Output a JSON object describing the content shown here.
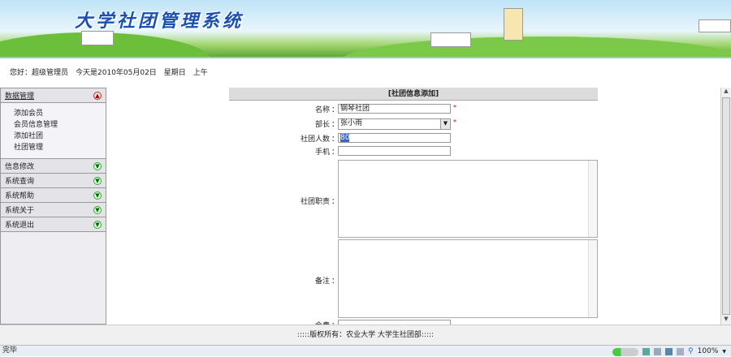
{
  "banner": {
    "title": "大学社团管理系统"
  },
  "greeting": "您好：超级管理员　今天是2010年05月02日　星期日　上午",
  "sidebar": {
    "open_menu": {
      "label": "数据管理",
      "items": [
        "添加会员",
        "会员信息管理",
        "添加社团",
        "社团管理"
      ]
    },
    "menus": [
      "信息修改",
      "系统查询",
      "系统帮助",
      "系统关于",
      "系统退出"
    ]
  },
  "form": {
    "title": "[社团信息添加]",
    "name_label": "名称",
    "name_value": "钢琴社团",
    "leader_label": "部长",
    "leader_value": "张小雨",
    "count_label": "社团人数",
    "count_value": "80",
    "phone_label": "手机",
    "phone_value": "",
    "duty_label": "社团职责",
    "note_label": "备注",
    "fee_label": "会费",
    "colon": "：",
    "required": "*"
  },
  "footer": ":::::版权所有：农业大学  大学生社团部:::::",
  "status": {
    "text": "完毕",
    "zoom": "100%"
  }
}
